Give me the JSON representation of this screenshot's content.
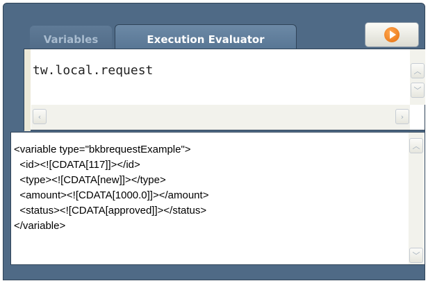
{
  "tabs": {
    "variables": "Variables",
    "execution_evaluator": "Execution Evaluator"
  },
  "toolbar": {
    "run_icon": "play-icon",
    "run_color": "#f07d14"
  },
  "editor": {
    "expression": "tw.local.request"
  },
  "output": {
    "lines": [
      "<variable type=\"bkbrequestExample\">",
      "  <id><![CDATA[117]]></id>",
      "  <type><![CDATA[new]]></type>",
      "  <amount><![CDATA[1000.0]]></amount>",
      "  <status><![CDATA[approved]]></status>",
      "</variable>"
    ]
  },
  "colors": {
    "panel": "#4f6a86",
    "active_tab": "#6c89a6"
  }
}
